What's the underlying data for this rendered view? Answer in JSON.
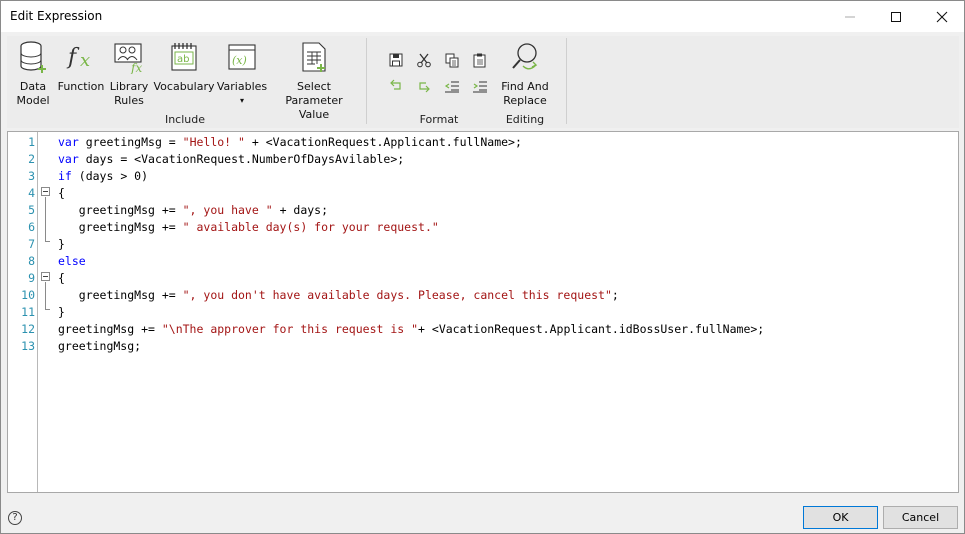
{
  "window": {
    "title": "Edit Expression"
  },
  "ribbon": {
    "include": {
      "label": "Include",
      "buttons": [
        {
          "line1": "Data",
          "line2": "Model",
          "icon": "database-icon"
        },
        {
          "line1": "Function",
          "line2": "",
          "icon": "function-icon"
        },
        {
          "line1": "Library",
          "line2": "Rules",
          "icon": "library-rules-icon"
        },
        {
          "line1": "Vocabulary",
          "line2": "",
          "icon": "vocabulary-icon"
        },
        {
          "line1": "Variables",
          "line2": "▾",
          "icon": "variables-icon"
        },
        {
          "line1": "Select Parameter",
          "line2": "Value",
          "icon": "select-parameter-icon"
        }
      ]
    },
    "format": {
      "label": "Format",
      "tools": [
        "save-icon",
        "cut-icon",
        "copy-icon",
        "paste-icon",
        "undo-icon",
        "redo-icon",
        "outdent-icon",
        "indent-icon"
      ]
    },
    "editing": {
      "label": "Editing",
      "find_line1": "Find And",
      "find_line2": "Replace"
    }
  },
  "editor": {
    "line_numbers": [
      "1",
      "2",
      "3",
      "4",
      "5",
      "6",
      "7",
      "8",
      "9",
      "10",
      "11",
      "12",
      "13"
    ],
    "lines": [
      [
        {
          "t": "kw",
          "v": "var"
        },
        {
          "t": "p",
          "v": " greetingMsg = "
        },
        {
          "t": "str",
          "v": "\"Hello! \""
        },
        {
          "t": "p",
          "v": " + <VacationRequest.Applicant.fullName>;"
        }
      ],
      [
        {
          "t": "kw",
          "v": "var"
        },
        {
          "t": "p",
          "v": " days = <VacationRequest.NumberOfDaysAvilable>;"
        }
      ],
      [
        {
          "t": "kw",
          "v": "if"
        },
        {
          "t": "p",
          "v": " (days > 0)"
        }
      ],
      [
        {
          "t": "p",
          "v": "{"
        }
      ],
      [
        {
          "t": "p",
          "v": "   greetingMsg += "
        },
        {
          "t": "str",
          "v": "\", you have \""
        },
        {
          "t": "p",
          "v": " + days;"
        }
      ],
      [
        {
          "t": "p",
          "v": "   greetingMsg += "
        },
        {
          "t": "str",
          "v": "\" available day(s) for your request.\""
        }
      ],
      [
        {
          "t": "p",
          "v": "}"
        }
      ],
      [
        {
          "t": "kw",
          "v": "else"
        }
      ],
      [
        {
          "t": "p",
          "v": "{"
        }
      ],
      [
        {
          "t": "p",
          "v": "   greetingMsg += "
        },
        {
          "t": "str",
          "v": "\", you don't have available days. Please, cancel this request\""
        },
        {
          "t": "p",
          "v": ";"
        }
      ],
      [
        {
          "t": "p",
          "v": "}"
        }
      ],
      [
        {
          "t": "p",
          "v": "greetingMsg += "
        },
        {
          "t": "str",
          "v": "\"\\nThe approver for this request is \""
        },
        {
          "t": "p",
          "v": "+ <VacationRequest.Applicant.idBossUser.fullName>;"
        }
      ],
      [
        {
          "t": "p",
          "v": "greetingMsg;"
        }
      ]
    ]
  },
  "footer": {
    "help": "?",
    "ok_label": "OK",
    "cancel_label": "Cancel"
  },
  "colors": {
    "keyword": "#0000ff",
    "string": "#a31515",
    "line_number": "#2b91af",
    "icon_green": "#7ab648"
  }
}
